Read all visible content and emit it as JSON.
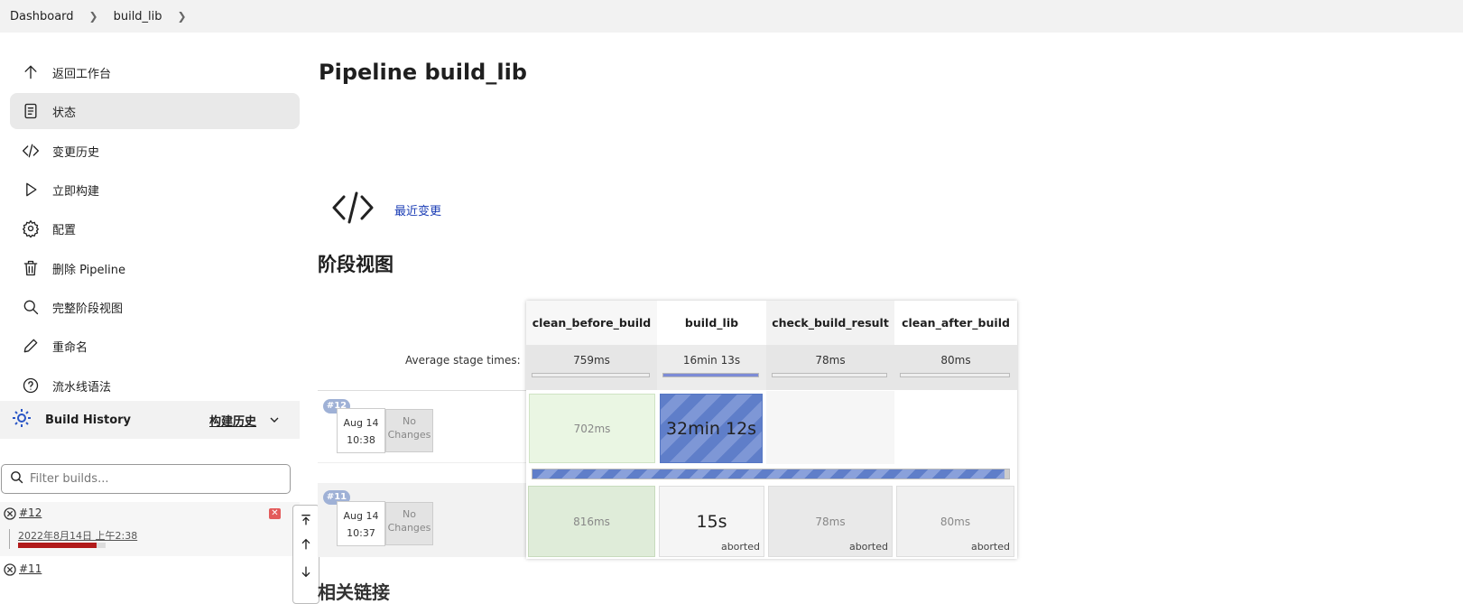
{
  "breadcrumb": {
    "items": [
      "Dashboard",
      "build_lib"
    ]
  },
  "sidebar": {
    "items": [
      {
        "label": "返回工作台",
        "icon": "arrow-up-icon"
      },
      {
        "label": "状态",
        "icon": "document-icon"
      },
      {
        "label": "变更历史",
        "icon": "code-icon"
      },
      {
        "label": "立即构建",
        "icon": "play-icon"
      },
      {
        "label": "配置",
        "icon": "gear-icon"
      },
      {
        "label": "删除 Pipeline",
        "icon": "trash-icon"
      },
      {
        "label": "完整阶段视图",
        "icon": "search-icon"
      },
      {
        "label": "重命名",
        "icon": "pencil-icon"
      },
      {
        "label": "流水线语法",
        "icon": "help-icon"
      }
    ],
    "active_index": 1
  },
  "build_history": {
    "title": "Build History",
    "trend_label": "构建历史",
    "filter_placeholder": "Filter builds...",
    "builds": [
      {
        "number": "#12",
        "date": "2022年8月14日 上午2:38",
        "progress": 0.9,
        "status": "aborted"
      },
      {
        "number": "#11",
        "status": "aborted"
      }
    ]
  },
  "main": {
    "title": "Pipeline build_lib",
    "recent_changes": "最近变更",
    "stage_view_title": "阶段视图",
    "next_section_title": "相关链接"
  },
  "stage_view": {
    "avg_label": "Average stage times:",
    "stages": [
      {
        "name": "clean_before_build",
        "avg": "759ms",
        "avg_fill": 0.0
      },
      {
        "name": "build_lib",
        "avg": "16min 13s",
        "avg_fill": 1.0
      },
      {
        "name": "check_build_result",
        "avg": "78ms",
        "avg_fill": 0.0
      },
      {
        "name": "clean_after_build",
        "avg": "80ms",
        "avg_fill": 0.0
      }
    ],
    "runs": [
      {
        "badge": "#12",
        "date": "Aug 14",
        "time": "10:38",
        "changes": "No Changes",
        "cells": [
          {
            "text": "702ms",
            "note": ""
          },
          {
            "text": "32min 12s",
            "note": ""
          },
          {
            "text": "",
            "note": ""
          },
          {
            "text": "",
            "note": ""
          }
        ],
        "progress": 0.99
      },
      {
        "badge": "#11",
        "date": "Aug 14",
        "time": "10:37",
        "changes": "No Changes",
        "cells": [
          {
            "text": "816ms",
            "note": ""
          },
          {
            "text": "15s",
            "note": "aborted"
          },
          {
            "text": "78ms",
            "note": "aborted"
          },
          {
            "text": "80ms",
            "note": "aborted"
          }
        ]
      }
    ]
  },
  "colors": {
    "success_light": "#eaf6e3",
    "success": "#dfecd9",
    "running": "#6a89cf",
    "aborted": "#ececec",
    "progress_red": "#b21a1a"
  }
}
